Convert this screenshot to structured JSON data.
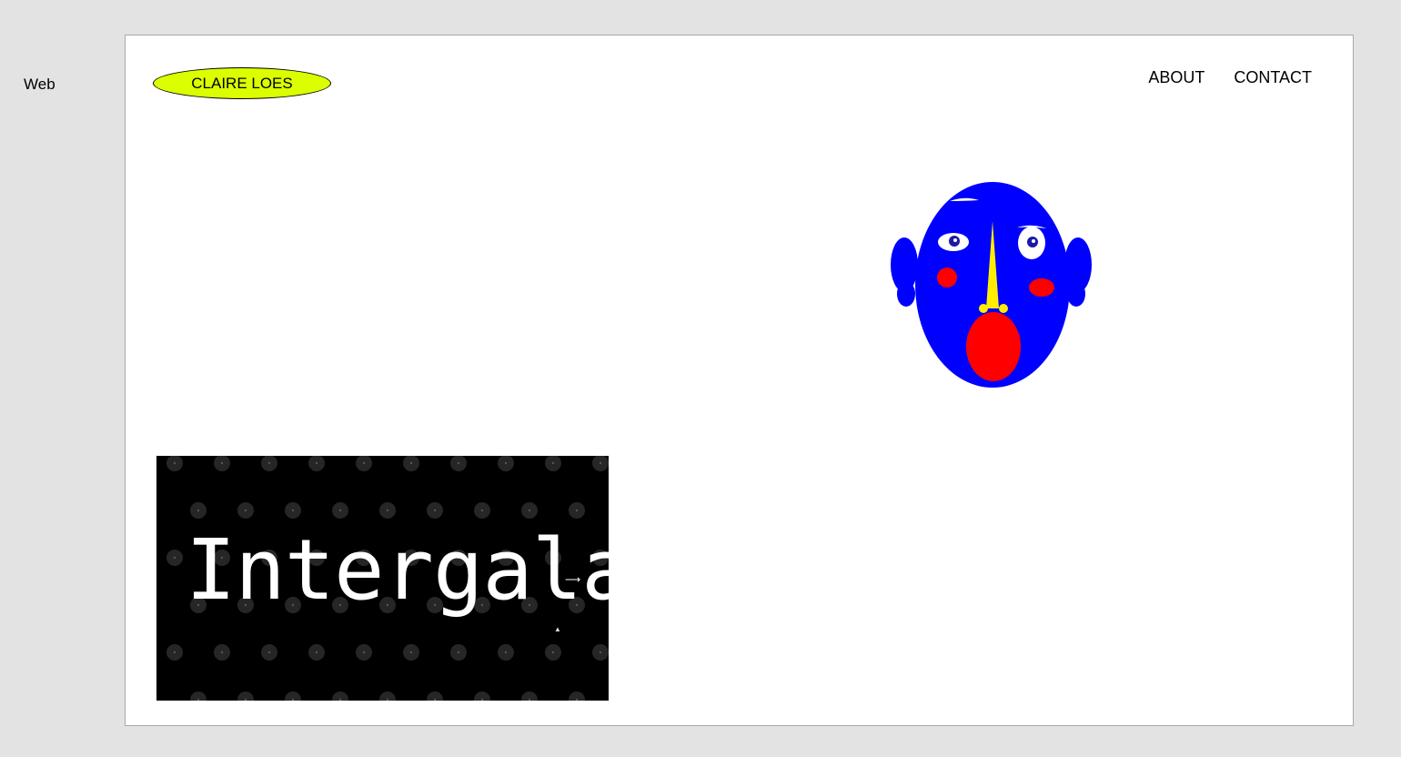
{
  "sidebar": {
    "label": "Web"
  },
  "header": {
    "logo": "CLAIRE LOES",
    "nav": [
      "ABOUT",
      "CONTACT"
    ]
  },
  "project": {
    "title": "Intergalactic"
  },
  "colors": {
    "logo_bg": "#dcff00",
    "face_blue": "#0000ff",
    "face_red": "#ff0000",
    "nose_yellow": "#ffee00",
    "tile_bg": "#000000"
  },
  "icons": {
    "face": "illustrated-face-icon",
    "arrow": "horizontal-arrow-icon",
    "cursor": "mouse-cursor-icon"
  }
}
